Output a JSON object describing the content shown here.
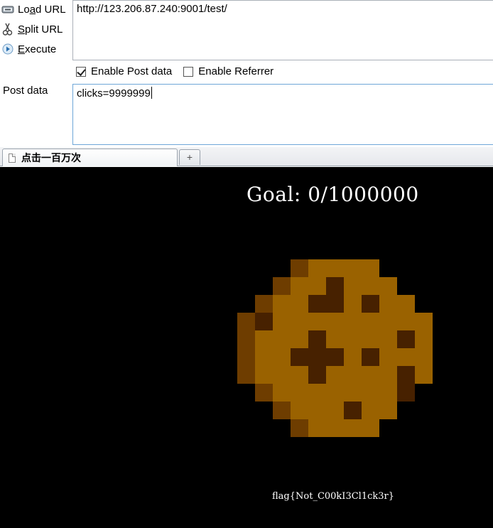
{
  "hackbar": {
    "load_url": {
      "pre": "Lo",
      "key": "a",
      "post": "d URL"
    },
    "split_url": {
      "pre": "",
      "key": "S",
      "post": "plit URL"
    },
    "execute": {
      "pre": "",
      "key": "E",
      "post": "xecute"
    },
    "url_value": "http://123.206.87.240:9001/test/",
    "enable_post_label": "Enable Post data",
    "enable_post_checked": true,
    "enable_referrer_label": "Enable Referrer",
    "enable_referrer_checked": false,
    "post_label": "Post data",
    "post_value": "clicks=9999999"
  },
  "tabs": [
    {
      "title": "点击一百万次",
      "active": true
    }
  ],
  "new_tab_symbol": "+",
  "page": {
    "goal_text": "Goal: 0/1000000",
    "goal": {
      "current": 0,
      "target": 1000000
    },
    "flag_text": "flag{Not_C00kI3Cl1ck3r}",
    "background": "#000000",
    "cookie_colors": {
      "light": "#9a6200",
      "mid": "#6e3d00",
      "dark": "#472100"
    },
    "icons": [
      "cookie-icon"
    ]
  }
}
